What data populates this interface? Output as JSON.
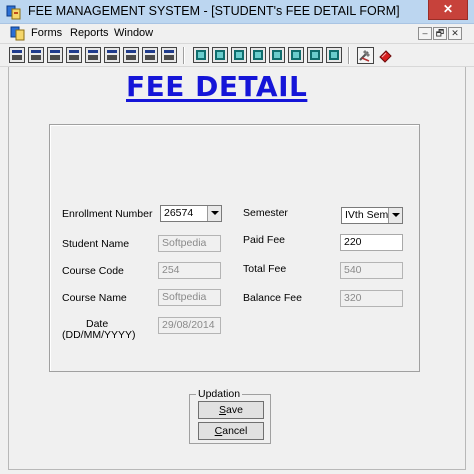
{
  "window": {
    "title": "FEE  MANAGEMENT SYSTEM - [STUDENT's FEE DETAIL FORM]",
    "close_label": "✕"
  },
  "menu": {
    "items": [
      "Forms",
      "Reports",
      "Window"
    ],
    "mdi_controls": [
      "–",
      "🗗",
      "✕"
    ]
  },
  "toolbar": {
    "group1_icons": [
      "form-icon",
      "form-icon",
      "form-icon",
      "form-icon",
      "form-icon",
      "form-icon",
      "form-icon",
      "form-icon",
      "form-icon",
      "form-icon"
    ],
    "group2_icons": [
      "report-icon",
      "report-icon",
      "report-icon",
      "report-icon",
      "report-icon",
      "report-icon",
      "report-icon",
      "report-icon"
    ],
    "extra_icons": [
      "tools-icon",
      "exit-icon"
    ]
  },
  "form": {
    "heading": "FEE DETAIL",
    "left": {
      "enrollment_label": "Enrollment Number",
      "enrollment_value": "26574",
      "student_name_label": "Student Name",
      "student_name_value": "Softpedia",
      "course_code_label": "Course Code",
      "course_code_value": "254",
      "course_name_label": "Course Name",
      "course_name_value": "Softpedia",
      "date_label_line1": "Date",
      "date_label_line2": "(DD/MM/YYYY)",
      "date_value": "29/08/2014"
    },
    "right": {
      "semester_label": "Semester",
      "semester_value": "IVth Semes",
      "paid_fee_label": "Paid Fee",
      "paid_fee_value": "220",
      "total_fee_label": "Total Fee",
      "total_fee_value": "540",
      "balance_fee_label": "Balance Fee",
      "balance_fee_value": "320"
    }
  },
  "updation": {
    "legend": "Updation",
    "save_first": "S",
    "save_rest": "ave",
    "cancel_first": "C",
    "cancel_rest": "ancel"
  },
  "colors": {
    "heading": "#1515d8",
    "titlebar": "#bcd6f0",
    "close": "#c7423b"
  }
}
